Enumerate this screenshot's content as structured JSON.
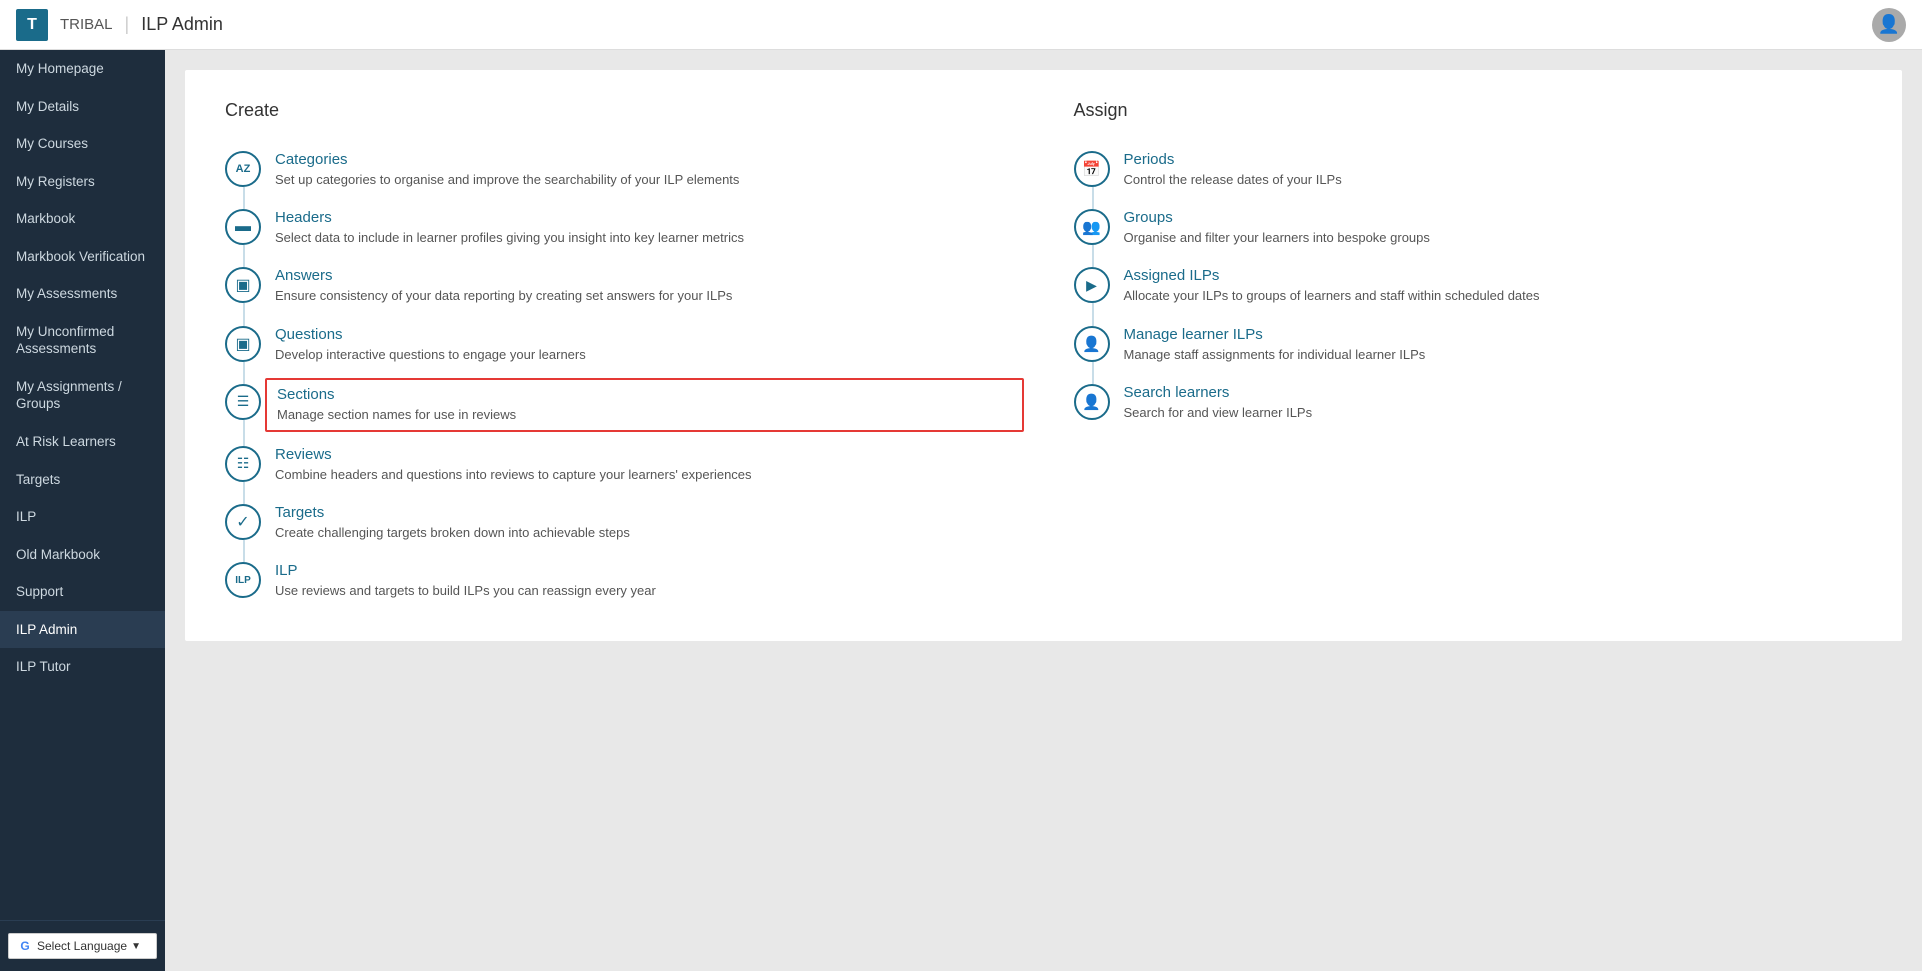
{
  "header": {
    "logo_letter": "T",
    "brand_name": "TRIBAL",
    "title": "ILP Admin"
  },
  "sidebar": {
    "items": [
      {
        "label": "My Homepage",
        "active": false
      },
      {
        "label": "My Details",
        "active": false
      },
      {
        "label": "My Courses",
        "active": false
      },
      {
        "label": "My Registers",
        "active": false
      },
      {
        "label": "Markbook",
        "active": false
      },
      {
        "label": "Markbook Verification",
        "active": false
      },
      {
        "label": "My Assessments",
        "active": false
      },
      {
        "label": "My Unconfirmed Assessments",
        "active": false
      },
      {
        "label": "My Assignments / Groups",
        "active": false
      },
      {
        "label": "At Risk Learners",
        "active": false
      },
      {
        "label": "Targets",
        "active": false
      },
      {
        "label": "ILP",
        "active": false
      },
      {
        "label": "Old Markbook",
        "active": false
      },
      {
        "label": "Support",
        "active": false
      },
      {
        "label": "ILP Admin",
        "active": true
      },
      {
        "label": "ILP Tutor",
        "active": false
      }
    ],
    "footer": {
      "select_language": "Select Language",
      "chevron": "▼"
    }
  },
  "main": {
    "create_section": {
      "title": "Create",
      "items": [
        {
          "icon": "AZ",
          "link": "Categories",
          "description": "Set up categories to organise and improve the searchability of your ILP elements",
          "highlighted": false
        },
        {
          "icon": "▤",
          "link": "Headers",
          "description": "Select data to include in learner profiles giving you insight into key learner metrics",
          "highlighted": false
        },
        {
          "icon": "▣",
          "link": "Answers",
          "description": "Ensure consistency of your data reporting by creating set answers for your ILPs",
          "highlighted": false
        },
        {
          "icon": "?",
          "link": "Questions",
          "description": "Develop interactive questions to engage your learners",
          "highlighted": false
        },
        {
          "icon": "☰",
          "link": "Sections",
          "description": "Manage section names for use in reviews",
          "highlighted": true
        },
        {
          "icon": "📋",
          "link": "Reviews",
          "description": "Combine headers and questions into reviews to capture your learners' experiences",
          "highlighted": false
        },
        {
          "icon": "✓",
          "link": "Targets",
          "description": "Create challenging targets broken down into achievable steps",
          "highlighted": false
        },
        {
          "icon": "ILP",
          "link": "ILP",
          "description": "Use reviews and targets to build ILPs you can reassign every year",
          "highlighted": false
        }
      ]
    },
    "assign_section": {
      "title": "Assign",
      "items": [
        {
          "icon": "📅",
          "link": "Periods",
          "description": "Control the release dates of your ILPs",
          "highlighted": false
        },
        {
          "icon": "👥",
          "link": "Groups",
          "description": "Organise and filter your learners into bespoke groups",
          "highlighted": false
        },
        {
          "icon": "▶",
          "link": "Assigned ILPs",
          "description": "Allocate your ILPs to groups of learners and staff within scheduled dates",
          "highlighted": false
        },
        {
          "icon": "👤",
          "link": "Manage learner ILPs",
          "description": "Manage staff assignments for individual learner ILPs",
          "highlighted": false
        },
        {
          "icon": "🔍",
          "link": "Search learners",
          "description": "Search for and view learner ILPs",
          "highlighted": false
        }
      ]
    }
  }
}
